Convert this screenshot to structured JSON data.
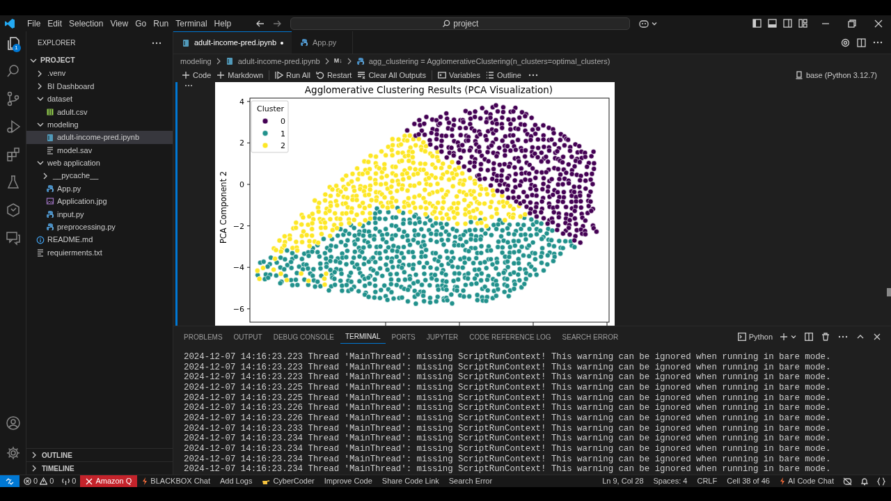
{
  "menu": [
    "File",
    "Edit",
    "Selection",
    "View",
    "Go",
    "Run",
    "Terminal",
    "Help"
  ],
  "command_center": {
    "value": "project"
  },
  "activity_bar": {
    "explorer_badge": "1"
  },
  "sidebar": {
    "title": "EXPLORER",
    "root": {
      "label": "PROJECT",
      "expanded": true,
      "children": [
        {
          "kind": "folder",
          "label": ".venv",
          "expanded": false,
          "selected": false
        },
        {
          "kind": "folder",
          "label": "BI Dashboard",
          "expanded": false,
          "selected": false
        },
        {
          "kind": "folder",
          "label": "dataset",
          "expanded": true,
          "selected": false,
          "children": [
            {
              "kind": "csv",
              "label": "adult.csv",
              "selected": false
            }
          ]
        },
        {
          "kind": "folder",
          "label": "modeling",
          "expanded": true,
          "selected": false,
          "children": [
            {
              "kind": "notebook",
              "label": "adult-income-pred.ipynb",
              "selected": true
            },
            {
              "kind": "file",
              "label": "model.sav",
              "selected": false
            }
          ]
        },
        {
          "kind": "folder",
          "label": "web application",
          "expanded": true,
          "selected": false,
          "children": [
            {
              "kind": "folder",
              "label": "__pycache__",
              "expanded": false,
              "selected": false
            },
            {
              "kind": "python",
              "label": "App.py",
              "selected": false
            },
            {
              "kind": "image",
              "label": "Application.jpg",
              "selected": false
            },
            {
              "kind": "python",
              "label": "input.py",
              "selected": false
            },
            {
              "kind": "python",
              "label": "preprocessing.py",
              "selected": false
            }
          ]
        },
        {
          "kind": "info",
          "label": "README.md",
          "selected": false
        },
        {
          "kind": "file",
          "label": "requierments.txt",
          "selected": false
        }
      ]
    },
    "sections": [
      {
        "label": "OUTLINE",
        "expanded": false
      },
      {
        "label": "TIMELINE",
        "expanded": false
      }
    ]
  },
  "editor_tabs": [
    {
      "label": "adult-income-pred.ipynb",
      "kind": "notebook",
      "selected": true,
      "modified": true
    },
    {
      "label": "App.py",
      "kind": "python",
      "selected": false,
      "modified": false
    }
  ],
  "breadcrumb": {
    "folder": "modeling",
    "file": "adult-income-pred.ipynb",
    "cell": "M↓",
    "symbol": "agg_clustering = AgglomerativeClustering(n_clusters=optimal_clusters)"
  },
  "notebook_toolbar": {
    "actions": [
      {
        "kind": "add",
        "label": "Code"
      },
      {
        "kind": "add",
        "label": "Markdown"
      },
      {
        "kind": "run",
        "label": "Run All"
      },
      {
        "kind": "restart",
        "label": "Restart"
      },
      {
        "kind": "clear",
        "label": "Clear All Outputs"
      },
      {
        "kind": "variables",
        "label": "Variables"
      },
      {
        "kind": "outline",
        "label": "Outline"
      }
    ],
    "kernel": "base (Python 3.12.7)"
  },
  "plot": {
    "title": "Agglomerative Clustering Results (PCA Visualization)",
    "ylabel": "PCA Component 2",
    "yticks": [
      "4",
      "2",
      "0",
      "−2",
      "−4",
      "−6"
    ],
    "legend": {
      "title": "Cluster",
      "items": [
        {
          "label": "0",
          "color": "#440154"
        },
        {
          "label": "1",
          "color": "#21918c"
        },
        {
          "label": "2",
          "color": "#fde725"
        }
      ]
    }
  },
  "panel": {
    "tabs": [
      {
        "label": "PROBLEMS",
        "selected": false
      },
      {
        "label": "OUTPUT",
        "selected": false
      },
      {
        "label": "DEBUG CONSOLE",
        "selected": false
      },
      {
        "label": "TERMINAL",
        "selected": true
      },
      {
        "label": "PORTS",
        "selected": false
      },
      {
        "label": "JUPYTER",
        "selected": false
      },
      {
        "label": "CODE REFERENCE LOG",
        "selected": false
      },
      {
        "label": "SEARCH ERROR",
        "selected": false
      }
    ],
    "terminal_name": "Python",
    "lines": [
      "2024-12-07 14:16:23.223 Thread 'MainThread': missing ScriptRunContext! This warning can be ignored when running in bare mode.",
      "2024-12-07 14:16:23.223 Thread 'MainThread': missing ScriptRunContext! This warning can be ignored when running in bare mode.",
      "2024-12-07 14:16:23.223 Thread 'MainThread': missing ScriptRunContext! This warning can be ignored when running in bare mode.",
      "2024-12-07 14:16:23.225 Thread 'MainThread': missing ScriptRunContext! This warning can be ignored when running in bare mode.",
      "2024-12-07 14:16:23.225 Thread 'MainThread': missing ScriptRunContext! This warning can be ignored when running in bare mode.",
      "2024-12-07 14:16:23.226 Thread 'MainThread': missing ScriptRunContext! This warning can be ignored when running in bare mode.",
      "2024-12-07 14:16:23.226 Thread 'MainThread': missing ScriptRunContext! This warning can be ignored when running in bare mode.",
      "2024-12-07 14:16:23.233 Thread 'MainThread': missing ScriptRunContext! This warning can be ignored when running in bare mode.",
      "2024-12-07 14:16:23.234 Thread 'MainThread': missing ScriptRunContext! This warning can be ignored when running in bare mode.",
      "2024-12-07 14:16:23.234 Thread 'MainThread': missing ScriptRunContext! This warning can be ignored when running in bare mode.",
      "2024-12-07 14:16:23.234 Thread 'MainThread': missing ScriptRunContext! This warning can be ignored when running in bare mode.",
      "2024-12-07 14:16:23.234 Thread 'MainThread': missing ScriptRunContext! This warning can be ignored when running in bare mode."
    ]
  },
  "status_bar": {
    "errors": "0",
    "warnings": "0",
    "ports": "0",
    "left_items": [
      {
        "kind": "error",
        "label": "Amazon Q"
      },
      {
        "kind": "bolt",
        "label": "BLACKBOX Chat"
      },
      {
        "kind": "plain",
        "label": "Add Logs"
      },
      {
        "kind": "hand",
        "label": "CyberCoder"
      },
      {
        "kind": "plain",
        "label": "Improve Code"
      },
      {
        "kind": "plain",
        "label": "Share Code Link"
      },
      {
        "kind": "plain",
        "label": "Search Error"
      }
    ],
    "right_items": [
      {
        "kind": "plain",
        "label": "Ln 9, Col 28"
      },
      {
        "kind": "plain",
        "label": "Spaces: 4"
      },
      {
        "kind": "plain",
        "label": "CRLF"
      },
      {
        "kind": "plain",
        "label": "Cell 38 of 46"
      },
      {
        "kind": "bolt",
        "label": "AI Code Chat"
      }
    ]
  }
}
